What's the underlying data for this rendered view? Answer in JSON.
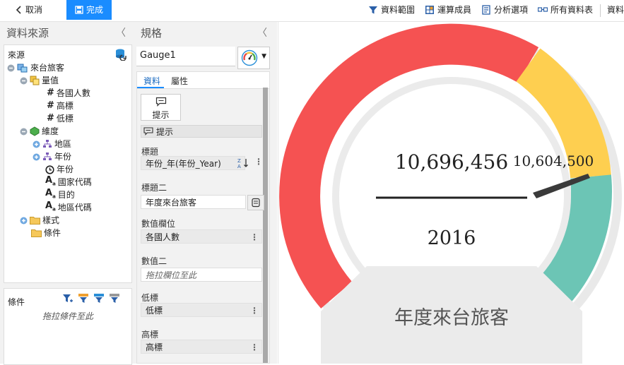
{
  "toolbar": {
    "cancel_label": "取消",
    "done_label": "完成",
    "data_range_label": "資料範圍",
    "calc_member_label": "運算成員",
    "analysis_options_label": "分析選項",
    "all_data_tables_label": "所有資料表",
    "data_label": "資料"
  },
  "left_panel": {
    "title": "資料來源",
    "source_label": "來源",
    "tree": {
      "root": "來台旅客",
      "measures": "量值",
      "measure_items": [
        "各國人數",
        "高標",
        "低標"
      ],
      "dimensions": "維度",
      "region": "地區",
      "year_hier": "年份",
      "year": "年份",
      "country_code": "國家代碼",
      "purpose": "目的",
      "region_code": "地區代碼",
      "style": "樣式",
      "condition": "條件"
    },
    "condition_panel": {
      "label": "條件",
      "placeholder": "拖拉條件至此"
    }
  },
  "spec_panel": {
    "title": "規格",
    "chart_name": "Gauge1",
    "tabs": [
      "資料",
      "屬性"
    ],
    "hint_button": "提示",
    "hint_row": "提示",
    "title_label": "標題",
    "title_value": "年份_年(年份_Year)",
    "subtitle_label": "標題二",
    "subtitle_value": "年度來台旅客",
    "value_label": "數值欄位",
    "value_value": "各國人數",
    "value2_label": "數值二",
    "value2_placeholder": "拖拉欄位至此",
    "low_label": "低標",
    "low_value": "低標",
    "high_label": "高標",
    "high_value": "高標"
  },
  "gauge": {
    "value_text": "10,696,456",
    "pointer_text": "10,604,500",
    "year_text": "2016",
    "caption": "年度來台旅客",
    "colors": {
      "red": "#f55252",
      "yellow": "#fecf50",
      "teal": "#6cc5b5",
      "ring": "#e9e9e9"
    }
  }
}
